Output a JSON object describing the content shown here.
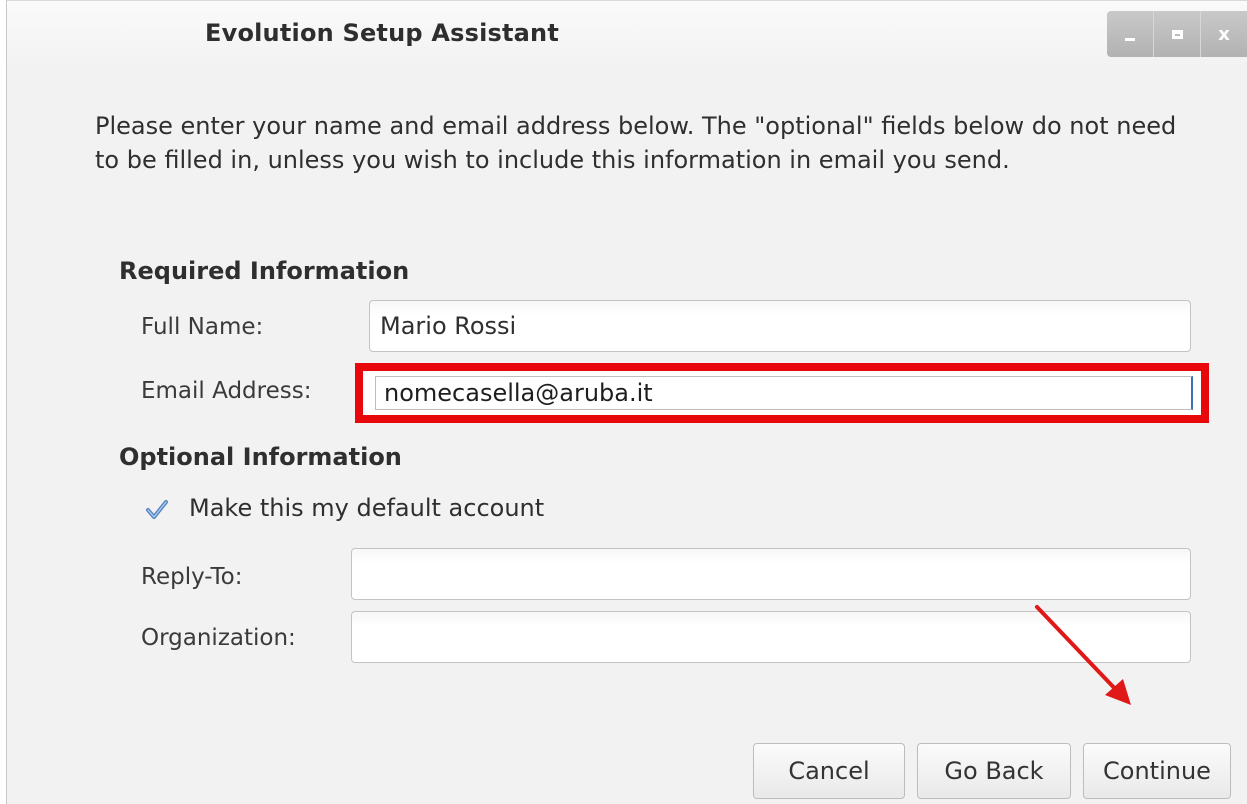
{
  "window": {
    "title": "Evolution Setup Assistant",
    "controls": [
      "minimize-icon",
      "maximize-icon",
      "close-icon"
    ],
    "close_glyph": "x"
  },
  "intro_text": "Please enter your name and email address below. The \"optional\" fields below do not need to be filled in, unless you wish to include this information in email you send.",
  "required_section": {
    "heading": "Required Information",
    "full_name": {
      "label": "Full Name:",
      "value": "Mario Rossi"
    },
    "email": {
      "label": "Email Address:",
      "value": "nomecasella@aruba.it"
    }
  },
  "optional_section": {
    "heading": "Optional Information",
    "default_account": {
      "label": "Make this my default account",
      "checked": true
    },
    "reply_to": {
      "label": "Reply-To:",
      "value": ""
    },
    "organization": {
      "label": "Organization:",
      "value": ""
    }
  },
  "buttons": {
    "cancel": "Cancel",
    "go_back": "Go Back",
    "continue": "Continue"
  },
  "annotation_colors": {
    "highlight": "#e8080c",
    "arrow": "#e01818"
  }
}
